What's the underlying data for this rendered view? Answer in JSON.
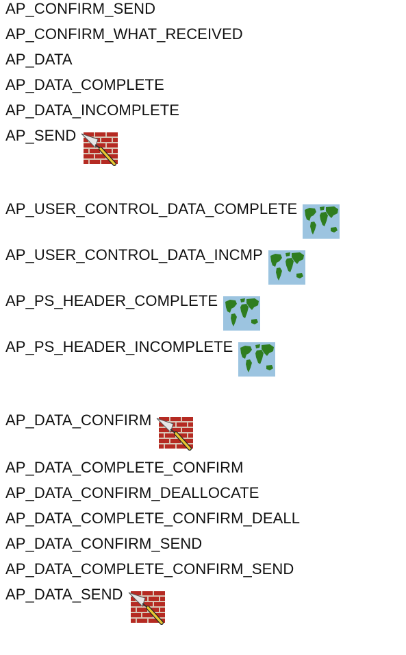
{
  "entries": [
    {
      "label": "AP_CONFIRM_SEND",
      "icon": null
    },
    {
      "label": "AP_CONFIRM_WHAT_RECEIVED",
      "icon": null
    },
    {
      "label": "AP_DATA",
      "icon": null
    },
    {
      "label": "AP_DATA_COMPLETE",
      "icon": null
    },
    {
      "label": "AP_DATA_INCOMPLETE",
      "icon": null
    },
    {
      "label": "AP_SEND",
      "icon": "brick-trowel-icon"
    },
    {
      "label": "AP_USER_CONTROL_DATA_COMPLETE",
      "icon": "world-map-icon"
    },
    {
      "label": "AP_USER_CONTROL_DATA_INCMP",
      "icon": "world-map-icon"
    },
    {
      "label": "AP_PS_HEADER_COMPLETE",
      "icon": "world-map-icon"
    },
    {
      "label": "AP_PS_HEADER_INCOMPLETE",
      "icon": "world-map-icon"
    },
    {
      "label": "AP_DATA_CONFIRM",
      "icon": "brick-trowel-icon"
    },
    {
      "label": "AP_DATA_COMPLETE_CONFIRM",
      "icon": null
    },
    {
      "label": "AP_DATA_CONFIRM_DEALLOCATE",
      "icon": null
    },
    {
      "label": "AP_DATA_COMPLETE_CONFIRM_DEALL",
      "icon": null
    },
    {
      "label": "AP_DATA_CONFIRM_SEND",
      "icon": null
    },
    {
      "label": "AP_DATA_COMPLETE_CONFIRM_SEND",
      "icon": null
    },
    {
      "label": "AP_DATA_SEND",
      "icon": "brick-trowel-icon"
    }
  ],
  "colors": {
    "text": "#111111",
    "brick": "#b52a22",
    "mortar": "#d8c4b4",
    "ocean": "#9cc4e0",
    "land": "#2f7d1f",
    "trowel_handle": "#e8c832",
    "trowel_blade": "#e6e6e6"
  }
}
